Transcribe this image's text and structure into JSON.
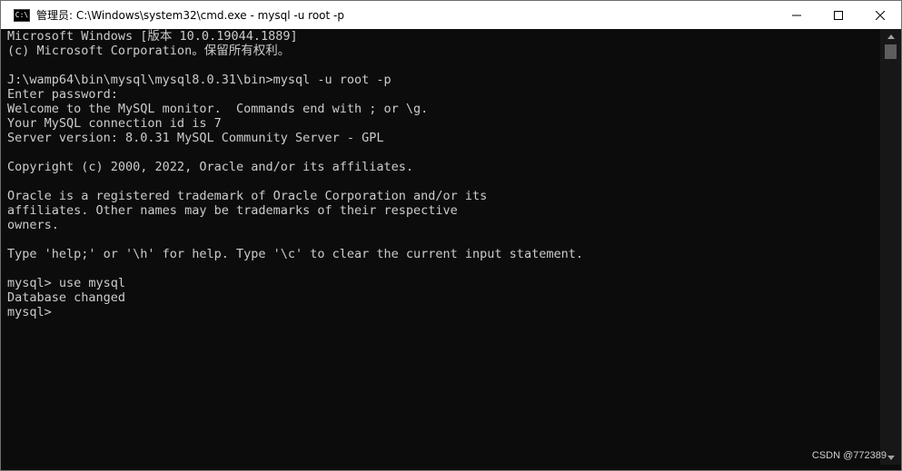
{
  "window": {
    "title": "管理员: C:\\Windows\\system32\\cmd.exe - mysql  -u root -p",
    "icon": "cmd-icon",
    "icon_text": "C:\\",
    "controls": [
      "minimize-icon",
      "maximize-icon",
      "close-icon"
    ]
  },
  "console": {
    "text": "Microsoft Windows [版本 10.0.19044.1889]\n(c) Microsoft Corporation。保留所有权利。\n\nJ:\\wamp64\\bin\\mysql\\mysql8.0.31\\bin>mysql -u root -p\nEnter password:\nWelcome to the MySQL monitor.  Commands end with ; or \\g.\nYour MySQL connection id is 7\nServer version: 8.0.31 MySQL Community Server - GPL\n\nCopyright (c) 2000, 2022, Oracle and/or its affiliates.\n\nOracle is a registered trademark of Oracle Corporation and/or its\naffiliates. Other names may be trademarks of their respective\nowners.\n\nType 'help;' or '\\h' for help. Type '\\c' to clear the current input statement.\n\nmysql> use mysql\nDatabase changed\nmysql>",
    "text_color": "#cccccc",
    "background": "#0c0c0c"
  },
  "watermark": "CSDN @772389"
}
